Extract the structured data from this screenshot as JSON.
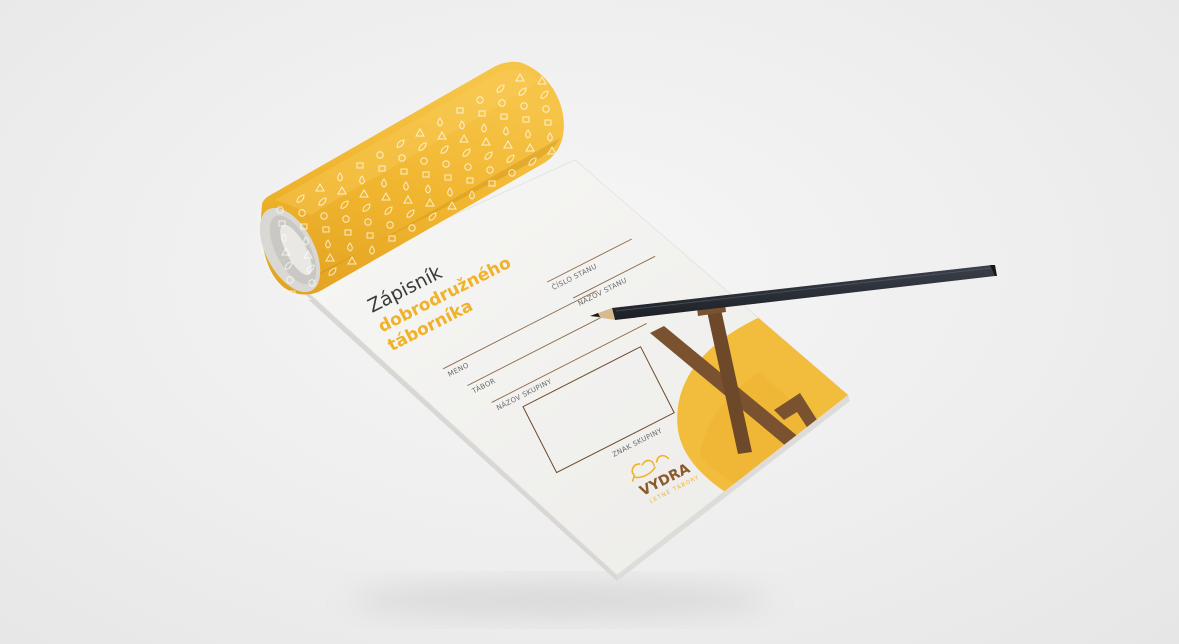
{
  "notebook": {
    "title_line1": "Zápisník",
    "title_line2": "dobrodružného",
    "title_line3": "táborníka",
    "fields": {
      "meno": "MENO",
      "tabor": "TÁBOR",
      "nazov_skupiny": "NÁZOV SKUPINY",
      "cislo_stanu": "ČÍSLO STANU",
      "nazov_stanu": "NÁZOV STANU",
      "znak_skupiny": "ZNAK SKUPINY"
    },
    "brand": {
      "name": "VYDRA",
      "tagline": "LETNÉ TÁBORY"
    }
  },
  "colors": {
    "accent_yellow": "#f0b62d",
    "accent_yellow_light": "#f3c54a",
    "brown": "#7a5230",
    "paper": "#f4f4f2",
    "pencil": "#2b2f36"
  }
}
